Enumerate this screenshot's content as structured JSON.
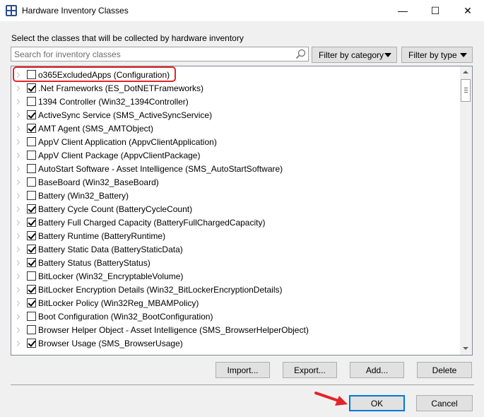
{
  "window": {
    "title": "Hardware Inventory Classes"
  },
  "titlebar_buttons": {
    "minimize": "—",
    "maximize": "☐",
    "close": "✕"
  },
  "instruction": "Select the classes that will be collected by hardware inventory",
  "search": {
    "placeholder": "Search for inventory classes",
    "value": ""
  },
  "filters": {
    "category": "Filter by category",
    "type": "Filter by type"
  },
  "classes": [
    {
      "label": "o365ExcludedApps (Configuration)",
      "checked": false
    },
    {
      "label": ".Net Frameworks (ES_DotNETFrameworks)",
      "checked": true
    },
    {
      "label": "1394 Controller (Win32_1394Controller)",
      "checked": false
    },
    {
      "label": "ActiveSync Service (SMS_ActiveSyncService)",
      "checked": true
    },
    {
      "label": "AMT Agent (SMS_AMTObject)",
      "checked": true
    },
    {
      "label": "AppV Client Application (AppvClientApplication)",
      "checked": false
    },
    {
      "label": "AppV Client Package (AppvClientPackage)",
      "checked": false
    },
    {
      "label": "AutoStart Software - Asset Intelligence (SMS_AutoStartSoftware)",
      "checked": false
    },
    {
      "label": "BaseBoard (Win32_BaseBoard)",
      "checked": false
    },
    {
      "label": "Battery (Win32_Battery)",
      "checked": false
    },
    {
      "label": "Battery Cycle Count (BatteryCycleCount)",
      "checked": true
    },
    {
      "label": "Battery Full Charged Capacity (BatteryFullChargedCapacity)",
      "checked": true
    },
    {
      "label": "Battery Runtime (BatteryRuntime)",
      "checked": true
    },
    {
      "label": "Battery Static Data (BatteryStaticData)",
      "checked": true
    },
    {
      "label": "Battery Status (BatteryStatus)",
      "checked": true
    },
    {
      "label": "BitLocker (Win32_EncryptableVolume)",
      "checked": false
    },
    {
      "label": "BitLocker Encryption Details (Win32_BitLockerEncryptionDetails)",
      "checked": true
    },
    {
      "label": "BitLocker Policy (Win32Reg_MBAMPolicy)",
      "checked": true
    },
    {
      "label": "Boot Configuration (Win32_BootConfiguration)",
      "checked": false
    },
    {
      "label": "Browser Helper Object - Asset Intelligence (SMS_BrowserHelperObject)",
      "checked": false
    },
    {
      "label": "Browser Usage (SMS_BrowserUsage)",
      "checked": true
    }
  ],
  "actions": {
    "import": "Import...",
    "export": "Export...",
    "add": "Add...",
    "delete": "Delete"
  },
  "footer": {
    "ok": "OK",
    "cancel": "Cancel"
  },
  "colors": {
    "highlight": "#e0252a",
    "accent": "#0078d7"
  }
}
